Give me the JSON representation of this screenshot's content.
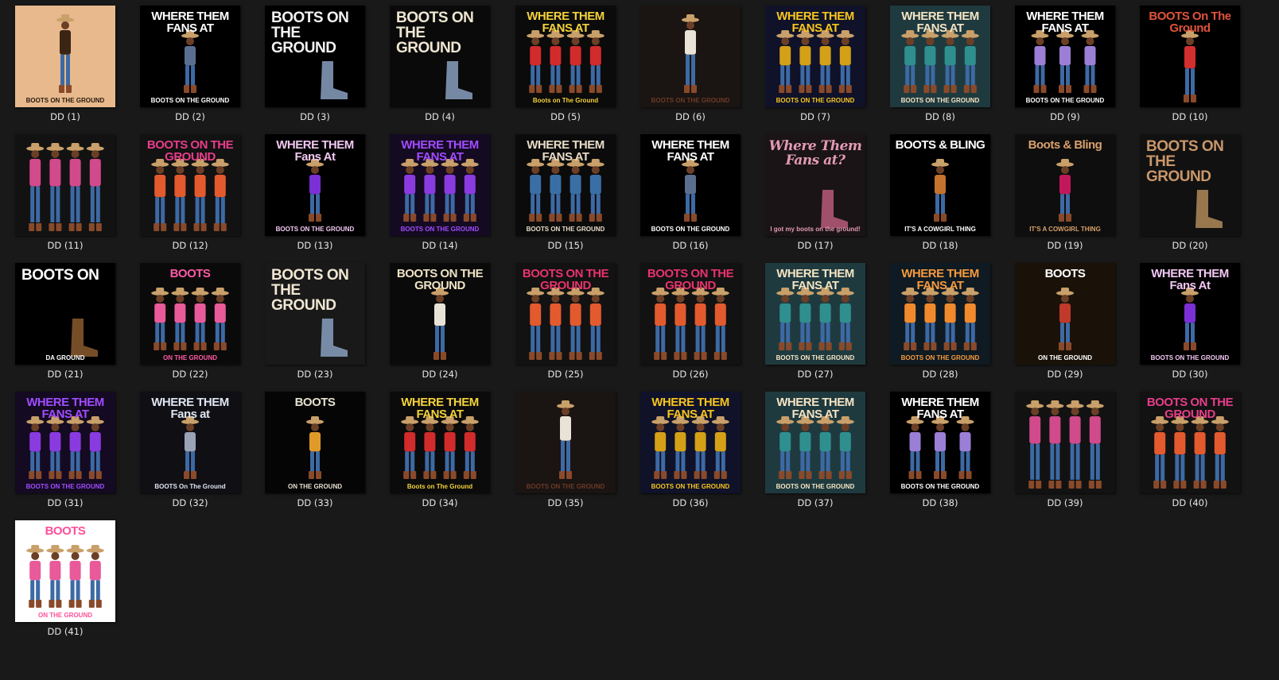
{
  "files": [
    {
      "label": "DD (1)",
      "head": "",
      "foot": "BOOTS ON THE GROUND",
      "bg": "#e7b98c",
      "accent": "#3a2414",
      "text": "#2a1a0f",
      "style": "figure-one"
    },
    {
      "label": "DD (2)",
      "head": "WHERE THEM FANS AT",
      "foot": "BOOTS ON THE GROUND",
      "bg": "#000000",
      "accent": "#5a6f8f",
      "text": "#ffffff",
      "style": "figure-one"
    },
    {
      "label": "DD (3)",
      "head": "BOOTS ON THE GROUND",
      "foot": "",
      "bg": "#000000",
      "accent": "#8aa0c0",
      "text": "#f2f2f2",
      "style": "text-big"
    },
    {
      "label": "DD (4)",
      "head": "BOOTS ON THE GROUND",
      "foot": "",
      "bg": "#0a0a0a",
      "accent": "#8aa0c0",
      "text": "#efe6d2",
      "style": "text-big"
    },
    {
      "label": "DD (5)",
      "head": "WHERE THEM FANS AT",
      "foot": "Boots on The Ground",
      "bg": "#0b0b0b",
      "accent": "#d12b2b",
      "text": "#f4d23a",
      "style": "group"
    },
    {
      "label": "DD (6)",
      "head": "",
      "foot": "BOOTS ON THE GROUND",
      "bg": "#1a1412",
      "accent": "#e9e2d6",
      "text": "#6b3a26",
      "style": "figure-one"
    },
    {
      "label": "DD (7)",
      "head": "WHERE THEM FANS AT",
      "foot": "BOOTS ON THE GROUND",
      "bg": "#0f1228",
      "accent": "#d4a017",
      "text": "#f7c51e",
      "style": "group"
    },
    {
      "label": "DD (8)",
      "head": "WHERE THEM FANS AT",
      "foot": "BOOTS ON THE GROUND",
      "bg": "#1f3a3f",
      "accent": "#2f8f8f",
      "text": "#f5e4c3",
      "style": "group"
    },
    {
      "label": "DD (9)",
      "head": "WHERE THEM FANS AT",
      "foot": "BOOTS ON THE GROUND",
      "bg": "#000000",
      "accent": "#9b7fd6",
      "text": "#ffffff",
      "style": "group-small"
    },
    {
      "label": "DD (10)",
      "head": "BOOTS On The Ground",
      "foot": "",
      "bg": "#000000",
      "accent": "#d32f2f",
      "text": "#e0533b",
      "style": "figure-one"
    },
    {
      "label": "DD (11)",
      "head": "",
      "foot": "",
      "bg": "#121212",
      "accent": "#d14a8b",
      "text": "#ffffff",
      "style": "group"
    },
    {
      "label": "DD (12)",
      "head": "BOOTS ON THE GROUND",
      "foot": "",
      "bg": "#121212",
      "accent": "#e35a2f",
      "text": "#e83d8a",
      "style": "group"
    },
    {
      "label": "DD (13)",
      "head": "WHERE THEM Fans At",
      "foot": "BOOTS ON THE GROUND",
      "bg": "#000000",
      "accent": "#7b2fd6",
      "text": "#f2c7f2",
      "style": "figure-one"
    },
    {
      "label": "DD (14)",
      "head": "WHERE THEM FANS AT",
      "foot": "BOOTS ON THE GROUND",
      "bg": "#140a22",
      "accent": "#8a3be0",
      "text": "#a24cff",
      "style": "group"
    },
    {
      "label": "DD (15)",
      "head": "WHERE THEM FANS AT",
      "foot": "BOOTS ON THE GROUND",
      "bg": "#0b0b0b",
      "accent": "#3a6fa5",
      "text": "#e8dcc8",
      "style": "group"
    },
    {
      "label": "DD (16)",
      "head": "WHERE THEM FANS AT",
      "foot": "BOOTS ON THE GROUND",
      "bg": "#000000",
      "accent": "#5a6f8f",
      "text": "#ffffff",
      "style": "figure-one"
    },
    {
      "label": "DD (17)",
      "head": "Where Them Fans at?",
      "foot": "I got my boots on the ground!",
      "bg": "#1a1416",
      "accent": "#b85a7a",
      "text": "#e39ab5",
      "style": "text-script"
    },
    {
      "label": "DD (18)",
      "head": "BOOTS & BLING",
      "foot": "IT'S A COWGIRL THING",
      "bg": "#000000",
      "accent": "#c4722e",
      "text": "#ffffff",
      "style": "figure-one"
    },
    {
      "label": "DD (19)",
      "head": "Boots & Bling",
      "foot": "IT'S A COWGIRL THING",
      "bg": "#0e0e0e",
      "accent": "#c2185b",
      "text": "#d9a06b",
      "style": "figure-one"
    },
    {
      "label": "DD (20)",
      "head": "BOOTS ON THE GROUND",
      "foot": "",
      "bg": "#111111",
      "accent": "#b08a5a",
      "text": "#c9976a",
      "style": "text-big"
    },
    {
      "label": "DD (21)",
      "head": "BOOTS ON",
      "foot": "DA GROUND",
      "bg": "#000000",
      "accent": "#8a5a2e",
      "text": "#ffffff",
      "style": "text-big"
    },
    {
      "label": "DD (22)",
      "head": "BOOTS",
      "foot": "ON THE GROUND",
      "bg": "#0a0a0a",
      "accent": "#e85a9a",
      "text": "#ff5aa5",
      "style": "group"
    },
    {
      "label": "DD (23)",
      "head": "BOOTS ON THE GROUND",
      "foot": "",
      "bg": "#191919",
      "accent": "#8aa0c0",
      "text": "#f0e6d2",
      "style": "text-big"
    },
    {
      "label": "DD (24)",
      "head": "BOOTS ON THE GROUND",
      "foot": "",
      "bg": "#0a0a0a",
      "accent": "#e9e2d6",
      "text": "#efe3c4",
      "style": "figure-one"
    },
    {
      "label": "DD (25)",
      "head": "BOOTS ON THE GROUND",
      "foot": "",
      "bg": "#121212",
      "accent": "#e35a2f",
      "text": "#e8336d",
      "style": "group"
    },
    {
      "label": "DD (26)",
      "head": "BOOTS ON THE GROUND",
      "foot": "",
      "bg": "#121212",
      "accent": "#e35a2f",
      "text": "#e8336d",
      "style": "group"
    },
    {
      "label": "DD (27)",
      "head": "WHERE THEM FANS AT",
      "foot": "BOOTS ON THE GROUND",
      "bg": "#1f3a3f",
      "accent": "#2f8f8f",
      "text": "#f5e4c3",
      "style": "group"
    },
    {
      "label": "DD (28)",
      "head": "WHERE THEM FANS AT",
      "foot": "BOOTS ON THE GROUND",
      "bg": "#0f1a22",
      "accent": "#f08a2c",
      "text": "#f79a3c",
      "style": "group"
    },
    {
      "label": "DD (29)",
      "head": "BOOTS",
      "foot": "ON THE GROUND",
      "bg": "#1a1208",
      "accent": "#c0392b",
      "text": "#ffffff",
      "style": "figure-one"
    },
    {
      "label": "DD (30)",
      "head": "WHERE THEM Fans At",
      "foot": "BOOTS ON THE GROUND",
      "bg": "#000000",
      "accent": "#7b2fd6",
      "text": "#f2c7f2",
      "style": "figure-one"
    },
    {
      "label": "DD (31)",
      "head": "WHERE THEM FANS AT",
      "foot": "BOOTS ON THE GROUND",
      "bg": "#140a22",
      "accent": "#8a3be0",
      "text": "#a24cff",
      "style": "group"
    },
    {
      "label": "DD (32)",
      "head": "WHERE THEM Fans at",
      "foot": "BOOTS On The Ground",
      "bg": "#0f0f14",
      "accent": "#9aa3b5",
      "text": "#dfe5f0",
      "style": "figure-one"
    },
    {
      "label": "DD (33)",
      "head": "BOOTS",
      "foot": "ON THE GROUND",
      "bg": "#050505",
      "accent": "#e09a2a",
      "text": "#e6e0d0",
      "style": "figure-one"
    },
    {
      "label": "DD (34)",
      "head": "WHERE THEM FANS AT",
      "foot": "Boots on The Ground",
      "bg": "#0b0b0b",
      "accent": "#d12b2b",
      "text": "#f4d23a",
      "style": "group"
    },
    {
      "label": "DD (35)",
      "head": "",
      "foot": "BOOTS ON THE GROUND",
      "bg": "#1a1412",
      "accent": "#e9e2d6",
      "text": "#6b3a26",
      "style": "figure-one"
    },
    {
      "label": "DD (36)",
      "head": "WHERE THEM FANS AT",
      "foot": "BOOTS ON THE GROUND",
      "bg": "#0f1228",
      "accent": "#d4a017",
      "text": "#f7c51e",
      "style": "group"
    },
    {
      "label": "DD (37)",
      "head": "WHERE THEM FANS AT",
      "foot": "BOOTS ON THE GROUND",
      "bg": "#1f3a3f",
      "accent": "#2f8f8f",
      "text": "#f5e4c3",
      "style": "group"
    },
    {
      "label": "DD (38)",
      "head": "WHERE THEM FANS AT",
      "foot": "BOOTS ON THE GROUND",
      "bg": "#000000",
      "accent": "#9b7fd6",
      "text": "#ffffff",
      "style": "group-small"
    },
    {
      "label": "DD (39)",
      "head": "",
      "foot": "",
      "bg": "#121212",
      "accent": "#d14a8b",
      "text": "#ffffff",
      "style": "group"
    },
    {
      "label": "DD (40)",
      "head": "BOOTS ON THE GROUND",
      "foot": "",
      "bg": "#121212",
      "accent": "#e35a2f",
      "text": "#e83d8a",
      "style": "group"
    },
    {
      "label": "DD (41)",
      "head": "BOOTS",
      "foot": "ON THE GROUND",
      "bg": "#ffffff",
      "accent": "#e85a9a",
      "text": "#ff4f9a",
      "style": "group"
    }
  ]
}
